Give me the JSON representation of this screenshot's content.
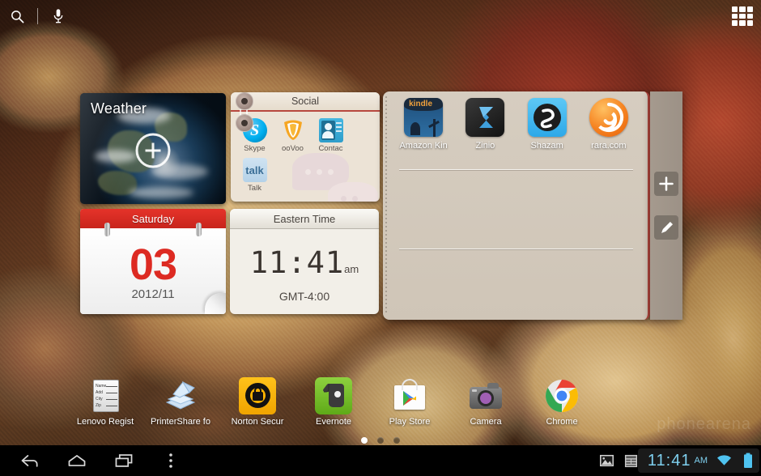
{
  "statusbar": {
    "search_icon": "search-icon",
    "mic_icon": "microphone-icon",
    "app_drawer_icon": "apps-grid-icon"
  },
  "widgets": {
    "weather": {
      "title": "Weather",
      "add_icon": "plus-circle-icon"
    },
    "social": {
      "title": "Social",
      "apps": [
        {
          "label": "Skype",
          "icon": "skype-icon"
        },
        {
          "label": "ooVoo",
          "icon": "oovoo-icon"
        },
        {
          "label": "Contac",
          "icon": "contacts-icon"
        },
        {
          "label": "Talk",
          "icon": "google-talk-icon"
        }
      ]
    },
    "calendar": {
      "weekday": "Saturday",
      "day": "03",
      "date": "2012/11"
    },
    "clock": {
      "title": "Eastern Time",
      "time": "11:41",
      "ampm": "am",
      "gmt": "GMT-4:00"
    },
    "app_panel": {
      "apps": [
        {
          "label": "Amazon Kin",
          "icon": "amazon-kindle-icon"
        },
        {
          "label": "Zinio",
          "icon": "zinio-icon"
        },
        {
          "label": "Shazam",
          "icon": "shazam-icon"
        },
        {
          "label": "rara.com",
          "icon": "rara-com-icon"
        }
      ]
    }
  },
  "right_toolbar": {
    "add_label": "+",
    "add_icon": "plus-icon",
    "edit_icon": "pencil-edit-icon"
  },
  "dock": {
    "apps": [
      {
        "label": "Lenovo Regist",
        "icon": "lenovo-registration-icon"
      },
      {
        "label": "PrinterShare fo",
        "icon": "printershare-icon"
      },
      {
        "label": "Norton Secur",
        "icon": "norton-security-icon"
      },
      {
        "label": "Evernote",
        "icon": "evernote-icon"
      },
      {
        "label": "Play Store",
        "icon": "google-play-store-icon"
      },
      {
        "label": "Camera",
        "icon": "camera-icon"
      },
      {
        "label": "Chrome",
        "icon": "google-chrome-icon"
      }
    ]
  },
  "page_indicator": {
    "count": 3,
    "active": 0
  },
  "watermark": "phonearena",
  "navbar": {
    "back_icon": "back-arrow-icon",
    "home_icon": "home-icon",
    "recents_icon": "recent-apps-icon",
    "menu_icon": "overflow-menu-icon",
    "screenshot_icon": "screenshot-icon",
    "notifications_icon": "notifications-list-icon",
    "time": "11:41",
    "ampm": "AM",
    "wifi_icon": "wifi-icon",
    "battery_icon": "battery-full-icon"
  },
  "colors": {
    "accent_red": "#c8241c",
    "status_blue": "#7fd0ef",
    "panel_beige": "#d2c8bb"
  }
}
